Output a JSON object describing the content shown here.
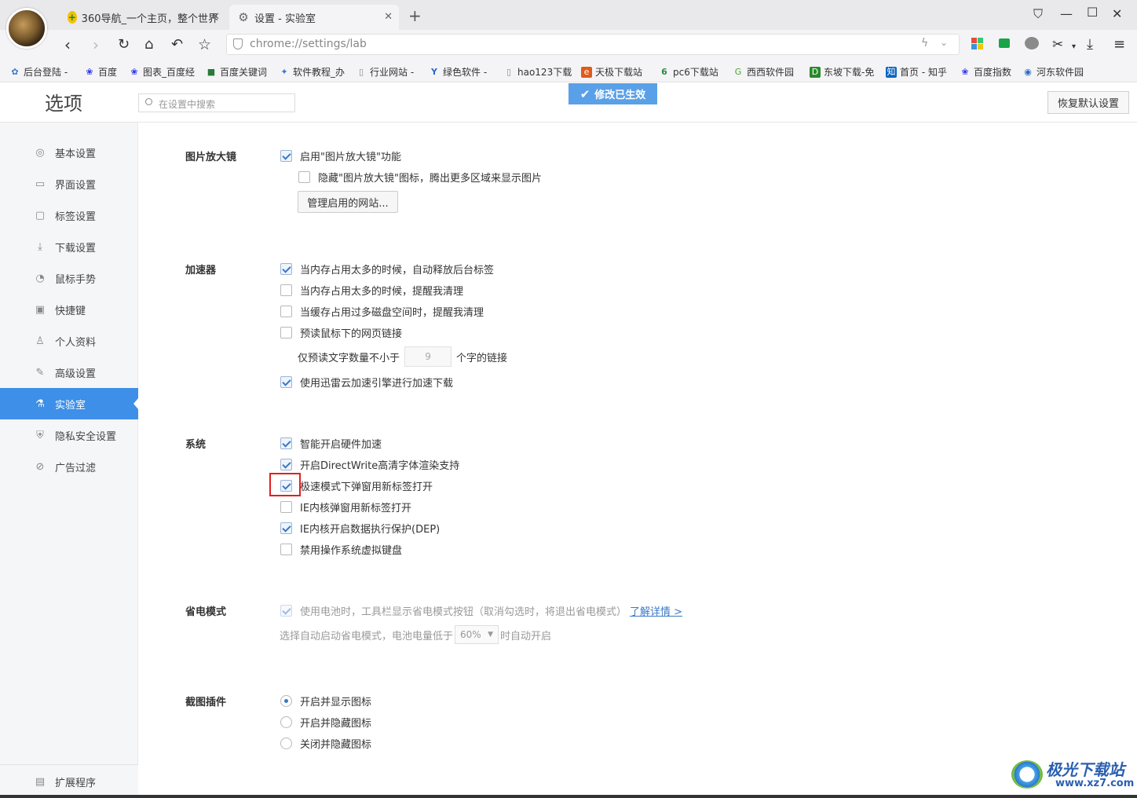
{
  "browser": {
    "tabs": [
      {
        "title": "360导航_一个主页，整个世界",
        "icon": "360-nav-icon"
      },
      {
        "title": "设置 - 实验室",
        "icon": "gear-icon"
      }
    ],
    "new_tab_symbol": "+",
    "address": "chrome://settings/lab",
    "window_controls": [
      "minimize",
      "maximize",
      "close"
    ]
  },
  "bookmarks": [
    {
      "label": "后台登陆 -",
      "icon": "bookmark-icon",
      "color": "#3a78c8"
    },
    {
      "label": "百度",
      "icon": "baidu-paw-icon",
      "color": "#2932e1"
    },
    {
      "label": "图表_百度经",
      "icon": "baidu-paw-icon",
      "color": "#2932e1"
    },
    {
      "label": "百度关键词",
      "icon": "bookmark-icon",
      "color": "#2a7a3a"
    },
    {
      "label": "软件教程_办",
      "icon": "bookmark-icon",
      "color": "#3a78c8"
    },
    {
      "label": "行业网站 -",
      "icon": "page-icon",
      "color": "#888888"
    },
    {
      "label": "绿色软件 -",
      "icon": "bookmark-icon",
      "color": "#2a6ac8"
    },
    {
      "label": "hao123下载",
      "icon": "page-icon",
      "color": "#888888"
    },
    {
      "label": "天极下载站",
      "icon": "bookmark-icon",
      "color": "#e05a1a"
    },
    {
      "label": "pc6下载站",
      "icon": "bookmark-icon",
      "color": "#2a8a4a"
    },
    {
      "label": "西西软件园",
      "icon": "bookmark-icon",
      "color": "#4aa32a"
    },
    {
      "label": "东坡下载-免",
      "icon": "bookmark-icon",
      "color": "#2a8a2a"
    },
    {
      "label": "首页 - 知乎",
      "icon": "zhihu-icon",
      "color": "#0a66c2"
    },
    {
      "label": "百度指数",
      "icon": "baidu-paw-icon",
      "color": "#2932e1"
    },
    {
      "label": "河东软件园",
      "icon": "bookmark-icon",
      "color": "#2a6ac8"
    }
  ],
  "header": {
    "title": "选项",
    "search_placeholder": "在设置中搜索",
    "toast": "修改已生效",
    "restore_button": "恢复默认设置"
  },
  "sidebar": {
    "items": [
      {
        "label": "基本设置",
        "icon": "basic-settings-icon",
        "active": false
      },
      {
        "label": "界面设置",
        "icon": "interface-icon",
        "active": false
      },
      {
        "label": "标签设置",
        "icon": "tab-icon",
        "active": false
      },
      {
        "label": "下载设置",
        "icon": "download-icon",
        "active": false
      },
      {
        "label": "鼠标手势",
        "icon": "mouse-icon",
        "active": false
      },
      {
        "label": "快捷键",
        "icon": "keyboard-icon",
        "active": false
      },
      {
        "label": "个人资料",
        "icon": "person-icon",
        "active": false
      },
      {
        "label": "高级设置",
        "icon": "wrench-icon",
        "active": false
      },
      {
        "label": "实验室",
        "icon": "flask-icon",
        "active": true
      },
      {
        "label": "隐私安全设置",
        "icon": "shield-icon",
        "active": false
      },
      {
        "label": "广告过滤",
        "icon": "block-icon",
        "active": false
      }
    ],
    "extensions": "扩展程序"
  },
  "sections": {
    "magnifier": {
      "title": "图片放大镜",
      "enable": {
        "label": "启用\"图片放大镜\"功能",
        "checked": true
      },
      "hide_icon": {
        "label": "隐藏\"图片放大镜\"图标，腾出更多区域来显示图片",
        "checked": false
      },
      "manage_button": "管理启用的网站..."
    },
    "accelerator": {
      "title": "加速器",
      "release_tabs": {
        "label": "当内存占用太多的时候，自动释放后台标签",
        "checked": true
      },
      "remind_memory": {
        "label": "当内存占用太多的时候，提醒我清理",
        "checked": false
      },
      "remind_disk": {
        "label": "当缓存占用过多磁盘空间时，提醒我清理",
        "checked": false
      },
      "preread": {
        "label": "预读鼠标下的网页链接",
        "checked": false
      },
      "preread_prefix": "仅预读文字数量不小于",
      "preread_value": "9",
      "preread_suffix": "个字的链接",
      "thunder": {
        "label": "使用迅雷云加速引擎进行加速下载",
        "checked": true
      }
    },
    "system": {
      "title": "系统",
      "hw_accel": {
        "label": "智能开启硬件加速",
        "checked": true
      },
      "directwrite": {
        "label": "开启DirectWrite高清字体渲染支持",
        "checked": true
      },
      "popup_newtab": {
        "label": "极速模式下弹窗用新标签打开",
        "checked": true
      },
      "ie_popup": {
        "label": "IE内核弹窗用新标签打开",
        "checked": false
      },
      "ie_dep": {
        "label": "IE内核开启数据执行保护(DEP)",
        "checked": true
      },
      "disable_vkb": {
        "label": "禁用操作系统虚拟键盘",
        "checked": false
      }
    },
    "power": {
      "title": "省电模式",
      "battery": {
        "label": "使用电池时，工具栏显示省电模式按钮（取消勾选时，将退出省电模式）",
        "checked": true
      },
      "learn_more": "了解详情 >",
      "auto_prefix": "选择自动启动省电模式，电池电量低于",
      "auto_value": "60%",
      "auto_suffix": "时自动开启"
    },
    "screenshot": {
      "title": "截图插件",
      "options": [
        {
          "label": "开启并显示图标",
          "selected": true
        },
        {
          "label": "开启并隐藏图标",
          "selected": false
        },
        {
          "label": "关闭并隐藏图标",
          "selected": false
        }
      ]
    }
  },
  "watermark": {
    "title": "极光下载站",
    "url": "www.xz7.com"
  }
}
